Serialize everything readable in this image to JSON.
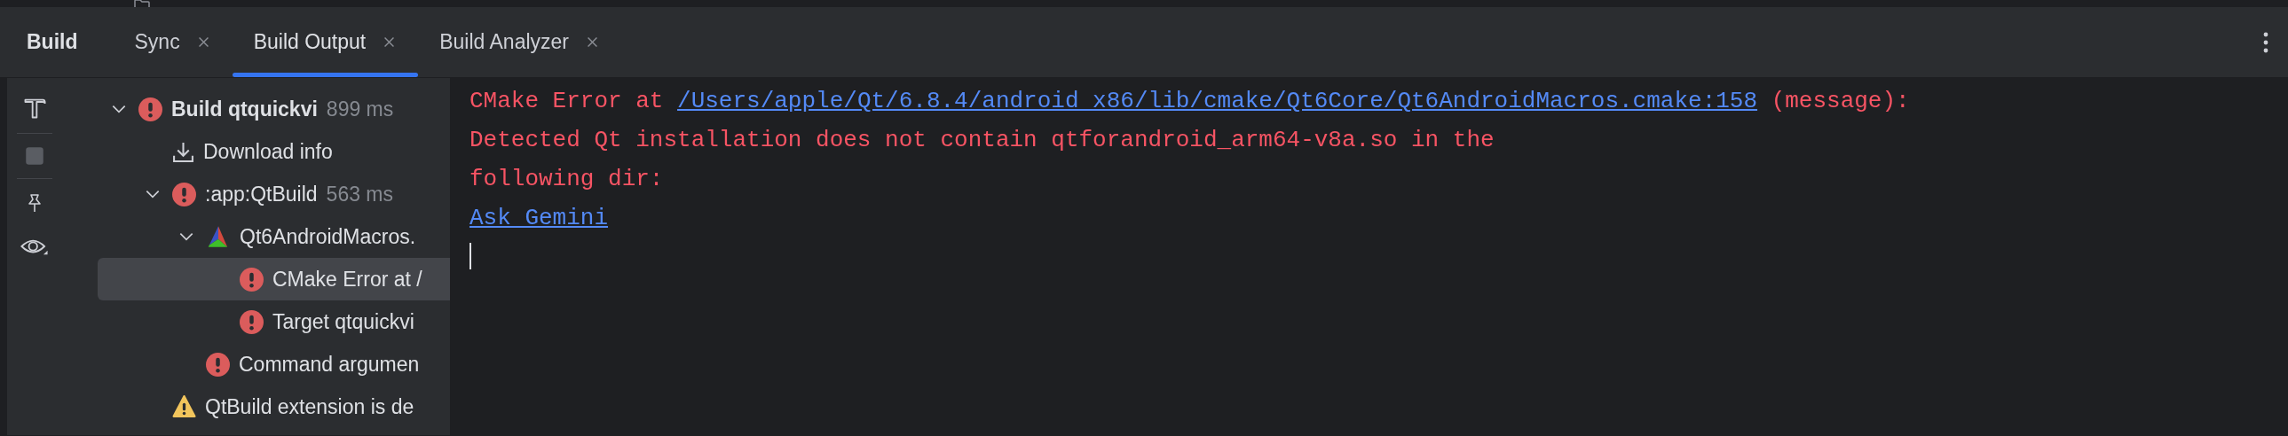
{
  "panel_title": "Build",
  "tabs": [
    {
      "label": "Sync",
      "selected": false
    },
    {
      "label": "Build Output",
      "selected": true
    },
    {
      "label": "Build Analyzer",
      "selected": false
    }
  ],
  "toolbar": [
    {
      "kind": "hammer",
      "disabled": false
    },
    {
      "kind": "stop",
      "disabled": true
    },
    {
      "kind": "pin",
      "disabled": false
    },
    {
      "kind": "eye",
      "disabled": false
    }
  ],
  "tree": [
    {
      "kind": "error",
      "label": "Build qtquickvi",
      "bold": true,
      "duration": "899 ms",
      "expanded": true,
      "selected": false,
      "children": [
        {
          "kind": "download",
          "label": "Download info",
          "selected": false
        },
        {
          "kind": "error",
          "label": ":app:QtBuild",
          "duration": "563 ms",
          "expanded": true,
          "selected": false,
          "children": [
            {
              "kind": "cmake",
              "label": "Qt6AndroidMacros.",
              "expanded": true,
              "selected": false,
              "children": [
                {
                  "kind": "error",
                  "label": "CMake Error at /",
                  "selected": true
                },
                {
                  "kind": "error",
                  "label": "Target qtquickvi",
                  "selected": false
                }
              ]
            },
            {
              "kind": "error",
              "label": "Command argumen",
              "selected": false
            }
          ]
        },
        {
          "kind": "warning",
          "label": "QtBuild extension is de",
          "selected": false
        }
      ]
    }
  ],
  "console": [
    [
      {
        "kind": "text",
        "text": "CMake Error at "
      },
      {
        "kind": "link",
        "text": "/Users/apple/Qt/6.8.4/android_x86/lib/cmake/Qt6Core/Qt6AndroidMacros.cmake:158"
      },
      {
        "kind": "text",
        "text": " (message):"
      }
    ],
    [
      {
        "kind": "text",
        "text": "Detected Qt installation does not contain qtforandroid_arm64-v8a.so in the"
      }
    ],
    [
      {
        "kind": "text",
        "text": "following dir:"
      }
    ],
    [
      {
        "kind": "link",
        "text": "Ask Gemini"
      }
    ]
  ]
}
